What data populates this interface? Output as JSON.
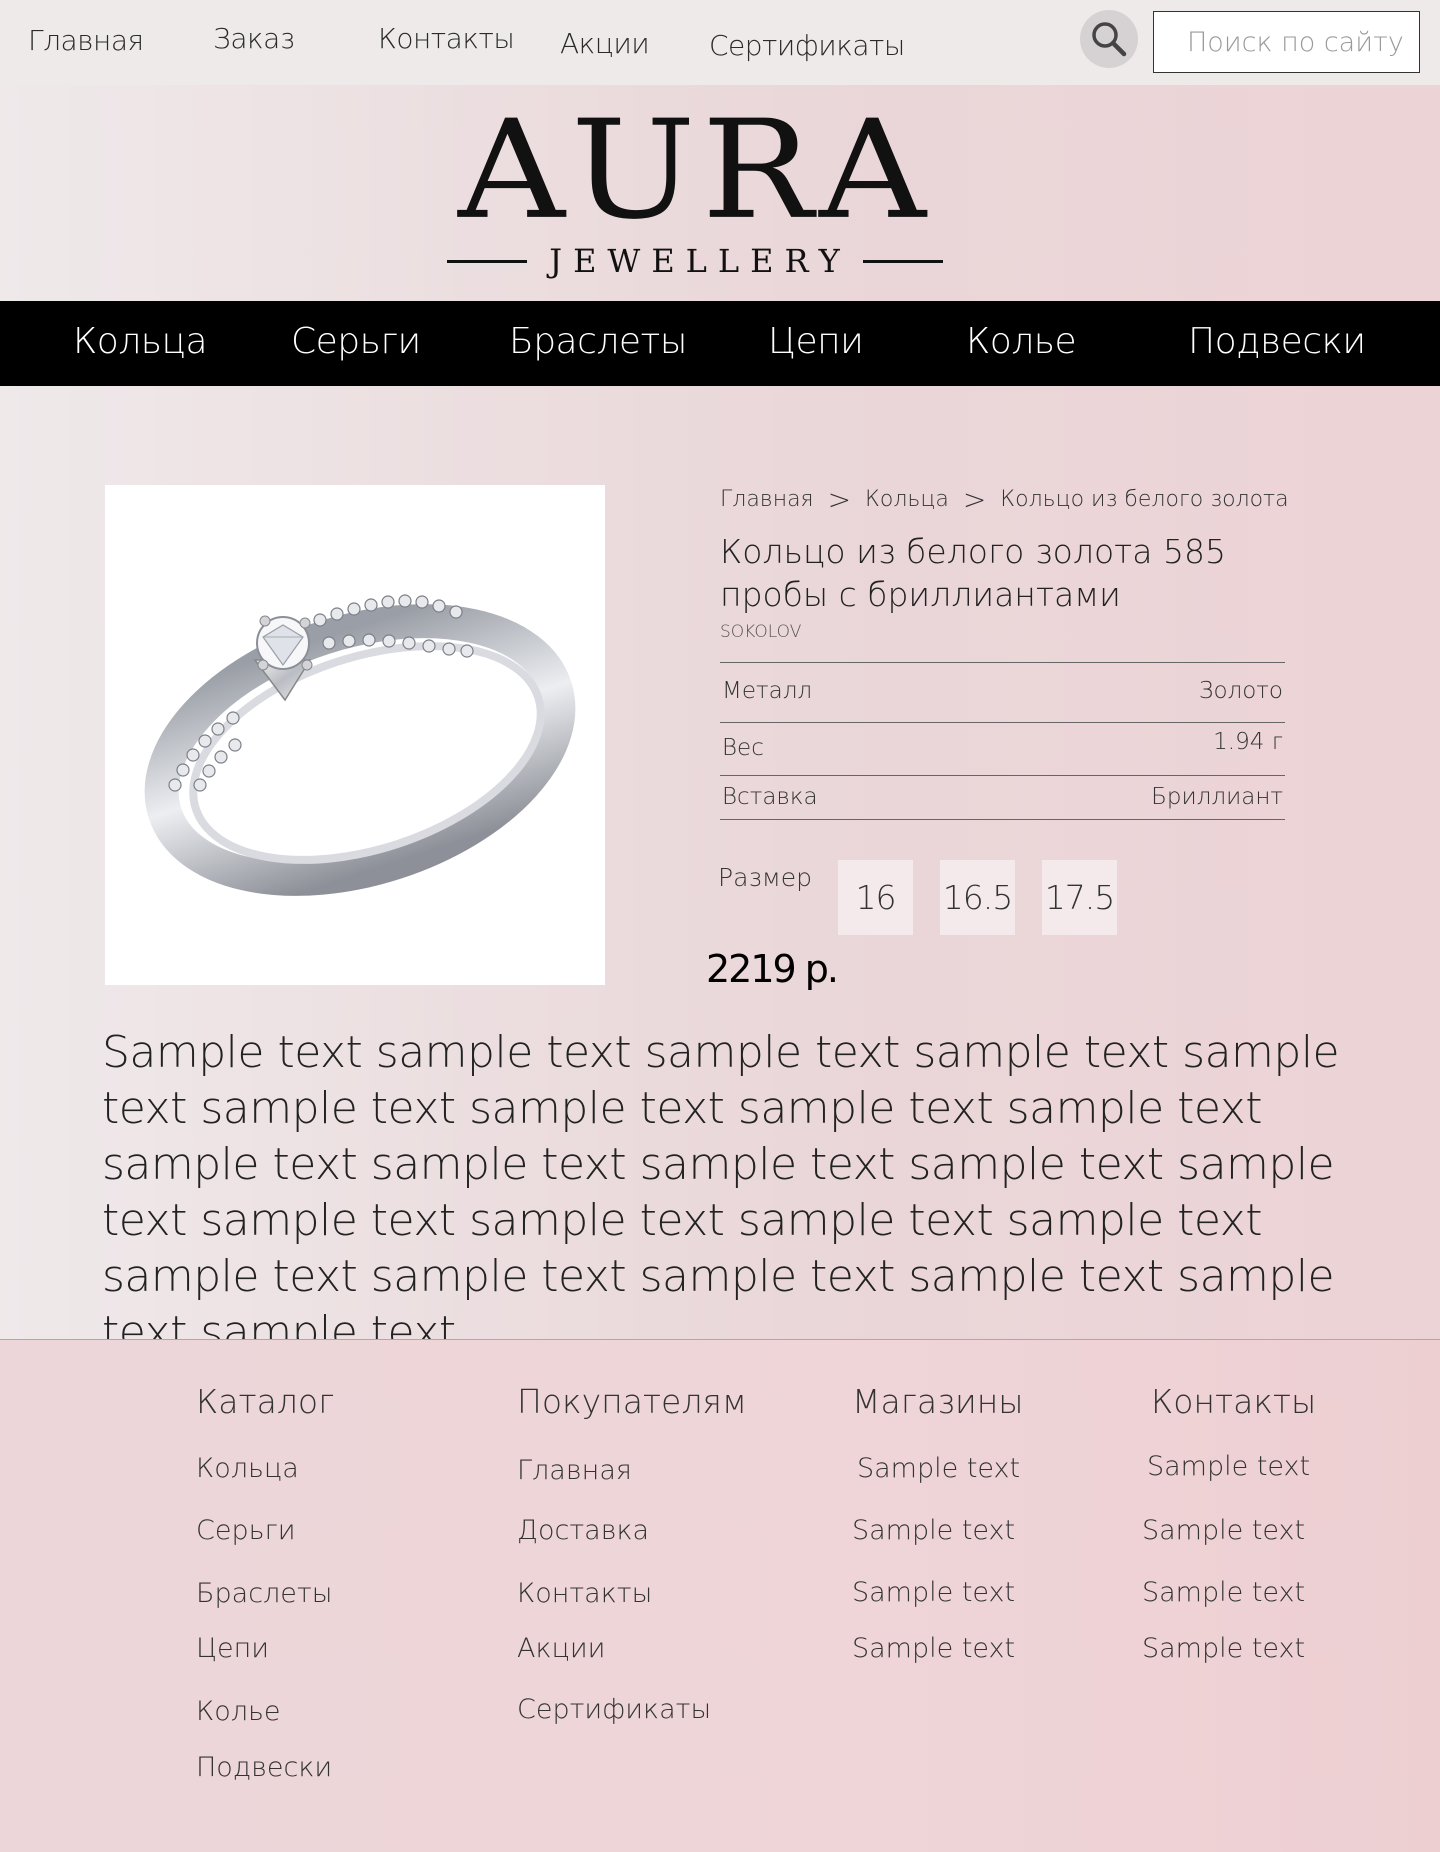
{
  "top_nav": [
    "Главная",
    "Заказ",
    "Контакты",
    "Акции",
    "Сертификаты"
  ],
  "search": {
    "placeholder": "Поиск по сайту",
    "icon": "search-icon"
  },
  "logo": {
    "main": "AURA",
    "sub": "JEWELLERY"
  },
  "categories": [
    "Кольца",
    "Серьги",
    "Браслеты",
    "Цепи",
    "Колье",
    "Подвески"
  ],
  "breadcrumb": [
    "Главная",
    "Кольца",
    "Кольцо из белого золота"
  ],
  "breadcrumb_sep": ">",
  "product": {
    "title": "Кольцо из белого золота 585 пробы с бриллиантами",
    "brand": "SOKOLOV",
    "specs": [
      {
        "label": "Металл",
        "value": "Золото"
      },
      {
        "label": "Вес",
        "value": "1.94 г"
      },
      {
        "label": "Вставка",
        "value": "Бриллиант"
      }
    ],
    "size_label": "Размер",
    "sizes": [
      "16",
      "16.5",
      "17.5"
    ],
    "price": "2219 р.",
    "description": "Sample text sample text sample text sample text sample text sample text sample text sample text sample text sample text sample text sample text sample text sample text sample text sample text sample text sample text sample text sample text sample text sample text sample text sample text"
  },
  "footer": {
    "catalog": {
      "title": "Каталог",
      "links": [
        "Кольца",
        "Серьги",
        "Браслеты",
        "Цепи",
        "Колье",
        "Подвески"
      ]
    },
    "buyers": {
      "title": "Покупателям",
      "links": [
        "Главная",
        "Доставка",
        "Контакты",
        "Акции",
        "Сертификаты"
      ]
    },
    "stores": {
      "title": "Магазины",
      "links": [
        "Sample text",
        "Sample text",
        "Sample text",
        "Sample text"
      ]
    },
    "contacts": {
      "title": "Контакты",
      "links": [
        "Sample text",
        "Sample text",
        "Sample text",
        "Sample text"
      ]
    }
  },
  "colors": {
    "nav_bg": "#000000",
    "accent_pink": "#ecd3d6",
    "size_bg": "#f4eaeb"
  }
}
